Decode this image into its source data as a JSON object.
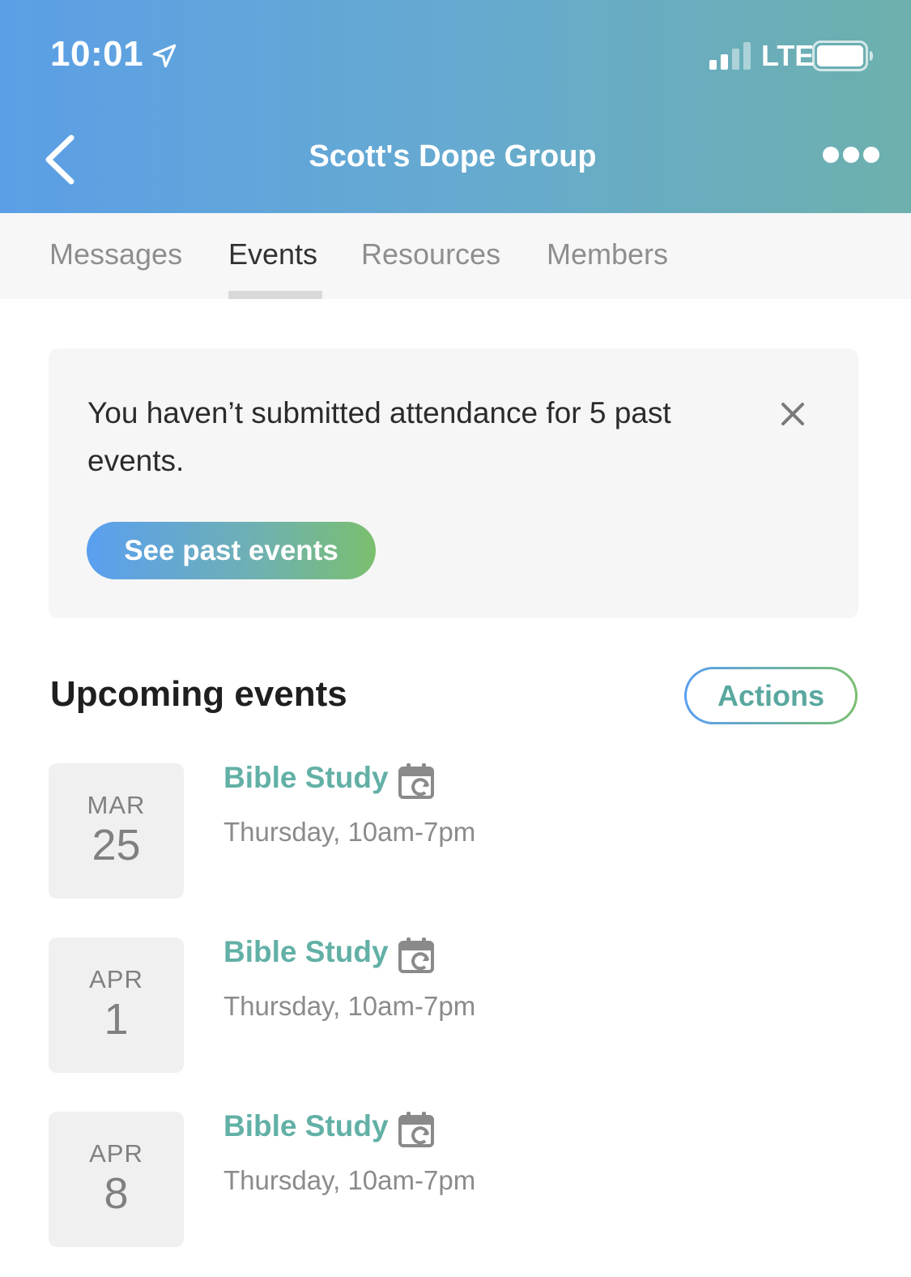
{
  "status_bar": {
    "time": "10:01",
    "network": "LTE"
  },
  "nav": {
    "title": "Scott's Dope Group"
  },
  "tabs": [
    {
      "label": "Messages",
      "active": false
    },
    {
      "label": "Events",
      "active": true
    },
    {
      "label": "Resources",
      "active": false
    },
    {
      "label": "Members",
      "active": false
    }
  ],
  "alert": {
    "message": "You haven’t submitted attendance for 5 past events.",
    "button_label": "See past events"
  },
  "upcoming": {
    "title": "Upcoming events",
    "actions_label": "Actions",
    "events": [
      {
        "month": "MAR",
        "day": "25",
        "title": "Bible Study",
        "time": "Thursday, 10am-7pm"
      },
      {
        "month": "APR",
        "day": "1",
        "title": "Bible Study",
        "time": "Thursday, 10am-7pm"
      },
      {
        "month": "APR",
        "day": "8",
        "title": "Bible Study",
        "time": "Thursday, 10am-7pm"
      }
    ]
  },
  "colors": {
    "header_gradient_start": "#5b9fe6",
    "header_gradient_end": "#6db0ad",
    "accent_teal": "#62b0a6",
    "button_gradient_end": "#7bbf6f"
  },
  "icons": {
    "location": "location-arrow-icon",
    "signal": "cellular-signal-icon",
    "battery": "battery-icon",
    "back": "chevron-left-icon",
    "more": "more-dots-icon",
    "close": "close-icon",
    "recurring": "recurring-calendar-icon"
  }
}
